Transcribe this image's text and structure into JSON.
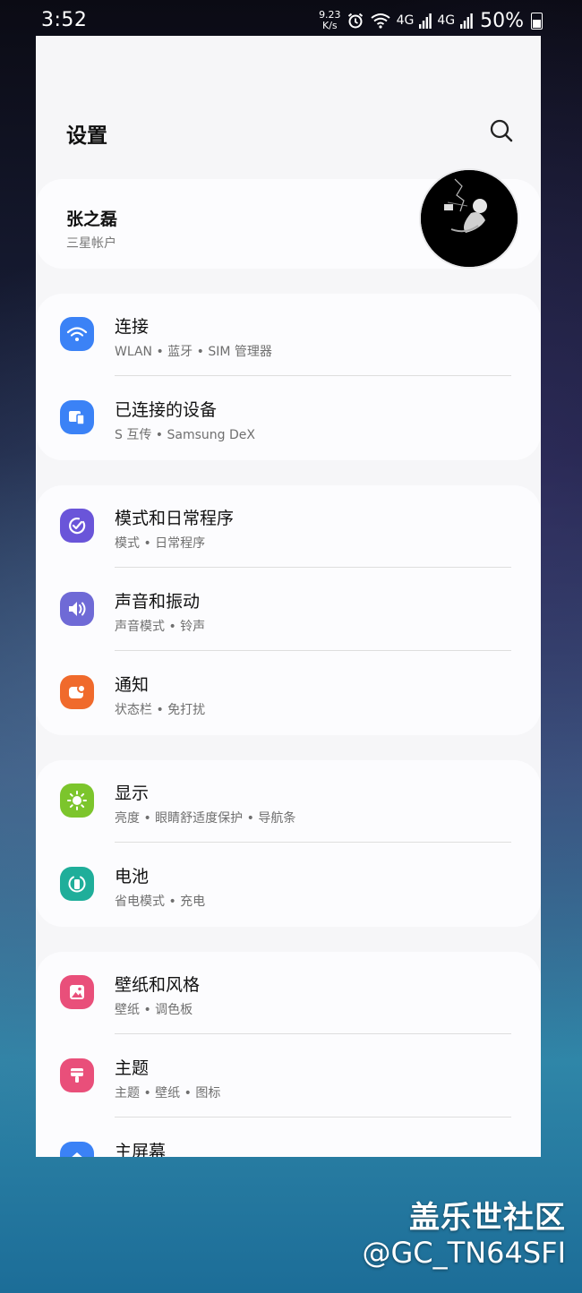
{
  "status": {
    "time": "3:52",
    "speed_value": "9.23",
    "speed_unit": "K/s",
    "net1": "4G",
    "net2": "4G",
    "battery": "50%",
    "icons": [
      "alarm-icon",
      "wifi-icon",
      "signal-icon",
      "battery-icon"
    ]
  },
  "header": {
    "title": "设置",
    "search_icon": "search-icon"
  },
  "account": {
    "name": "张之磊",
    "subtitle": "三星帐户"
  },
  "groups": [
    {
      "items": [
        {
          "title": "连接",
          "subtitle": "WLAN • 蓝牙 • SIM 管理器",
          "icon": "wifi-icon",
          "color": "#3b82f6"
        },
        {
          "title": "已连接的设备",
          "subtitle": "S 互传 • Samsung DeX",
          "icon": "connected-devices-icon",
          "color": "#3b82f6"
        }
      ]
    },
    {
      "items": [
        {
          "title": "模式和日常程序",
          "subtitle": "模式 • 日常程序",
          "icon": "modes-routines-icon",
          "color": "#6a55d9"
        },
        {
          "title": "声音和振动",
          "subtitle": "声音模式 • 铃声",
          "icon": "sound-icon",
          "color": "#6f6ad6"
        },
        {
          "title": "通知",
          "subtitle": "状态栏 • 免打扰",
          "icon": "notification-icon",
          "color": "#f06a2c"
        }
      ]
    },
    {
      "items": [
        {
          "title": "显示",
          "subtitle": "亮度 • 眼睛舒适度保护 • 导航条",
          "icon": "display-icon",
          "color": "#7cc52c"
        },
        {
          "title": "电池",
          "subtitle": "省电模式 • 充电",
          "icon": "battery-icon",
          "color": "#1fae9a"
        }
      ]
    },
    {
      "items": [
        {
          "title": "壁纸和风格",
          "subtitle": "壁纸 • 调色板",
          "icon": "wallpaper-icon",
          "color": "#e94f7a"
        },
        {
          "title": "主题",
          "subtitle": "主题 • 壁纸 • 图标",
          "icon": "themes-icon",
          "color": "#e94f7a"
        },
        {
          "title": "主屏幕",
          "subtitle": "",
          "icon": "home-screen-icon",
          "color": "#3b82f6"
        }
      ]
    }
  ],
  "watermark": {
    "line1": "盖乐世社区",
    "line2": "@GC_TN64SFI"
  }
}
